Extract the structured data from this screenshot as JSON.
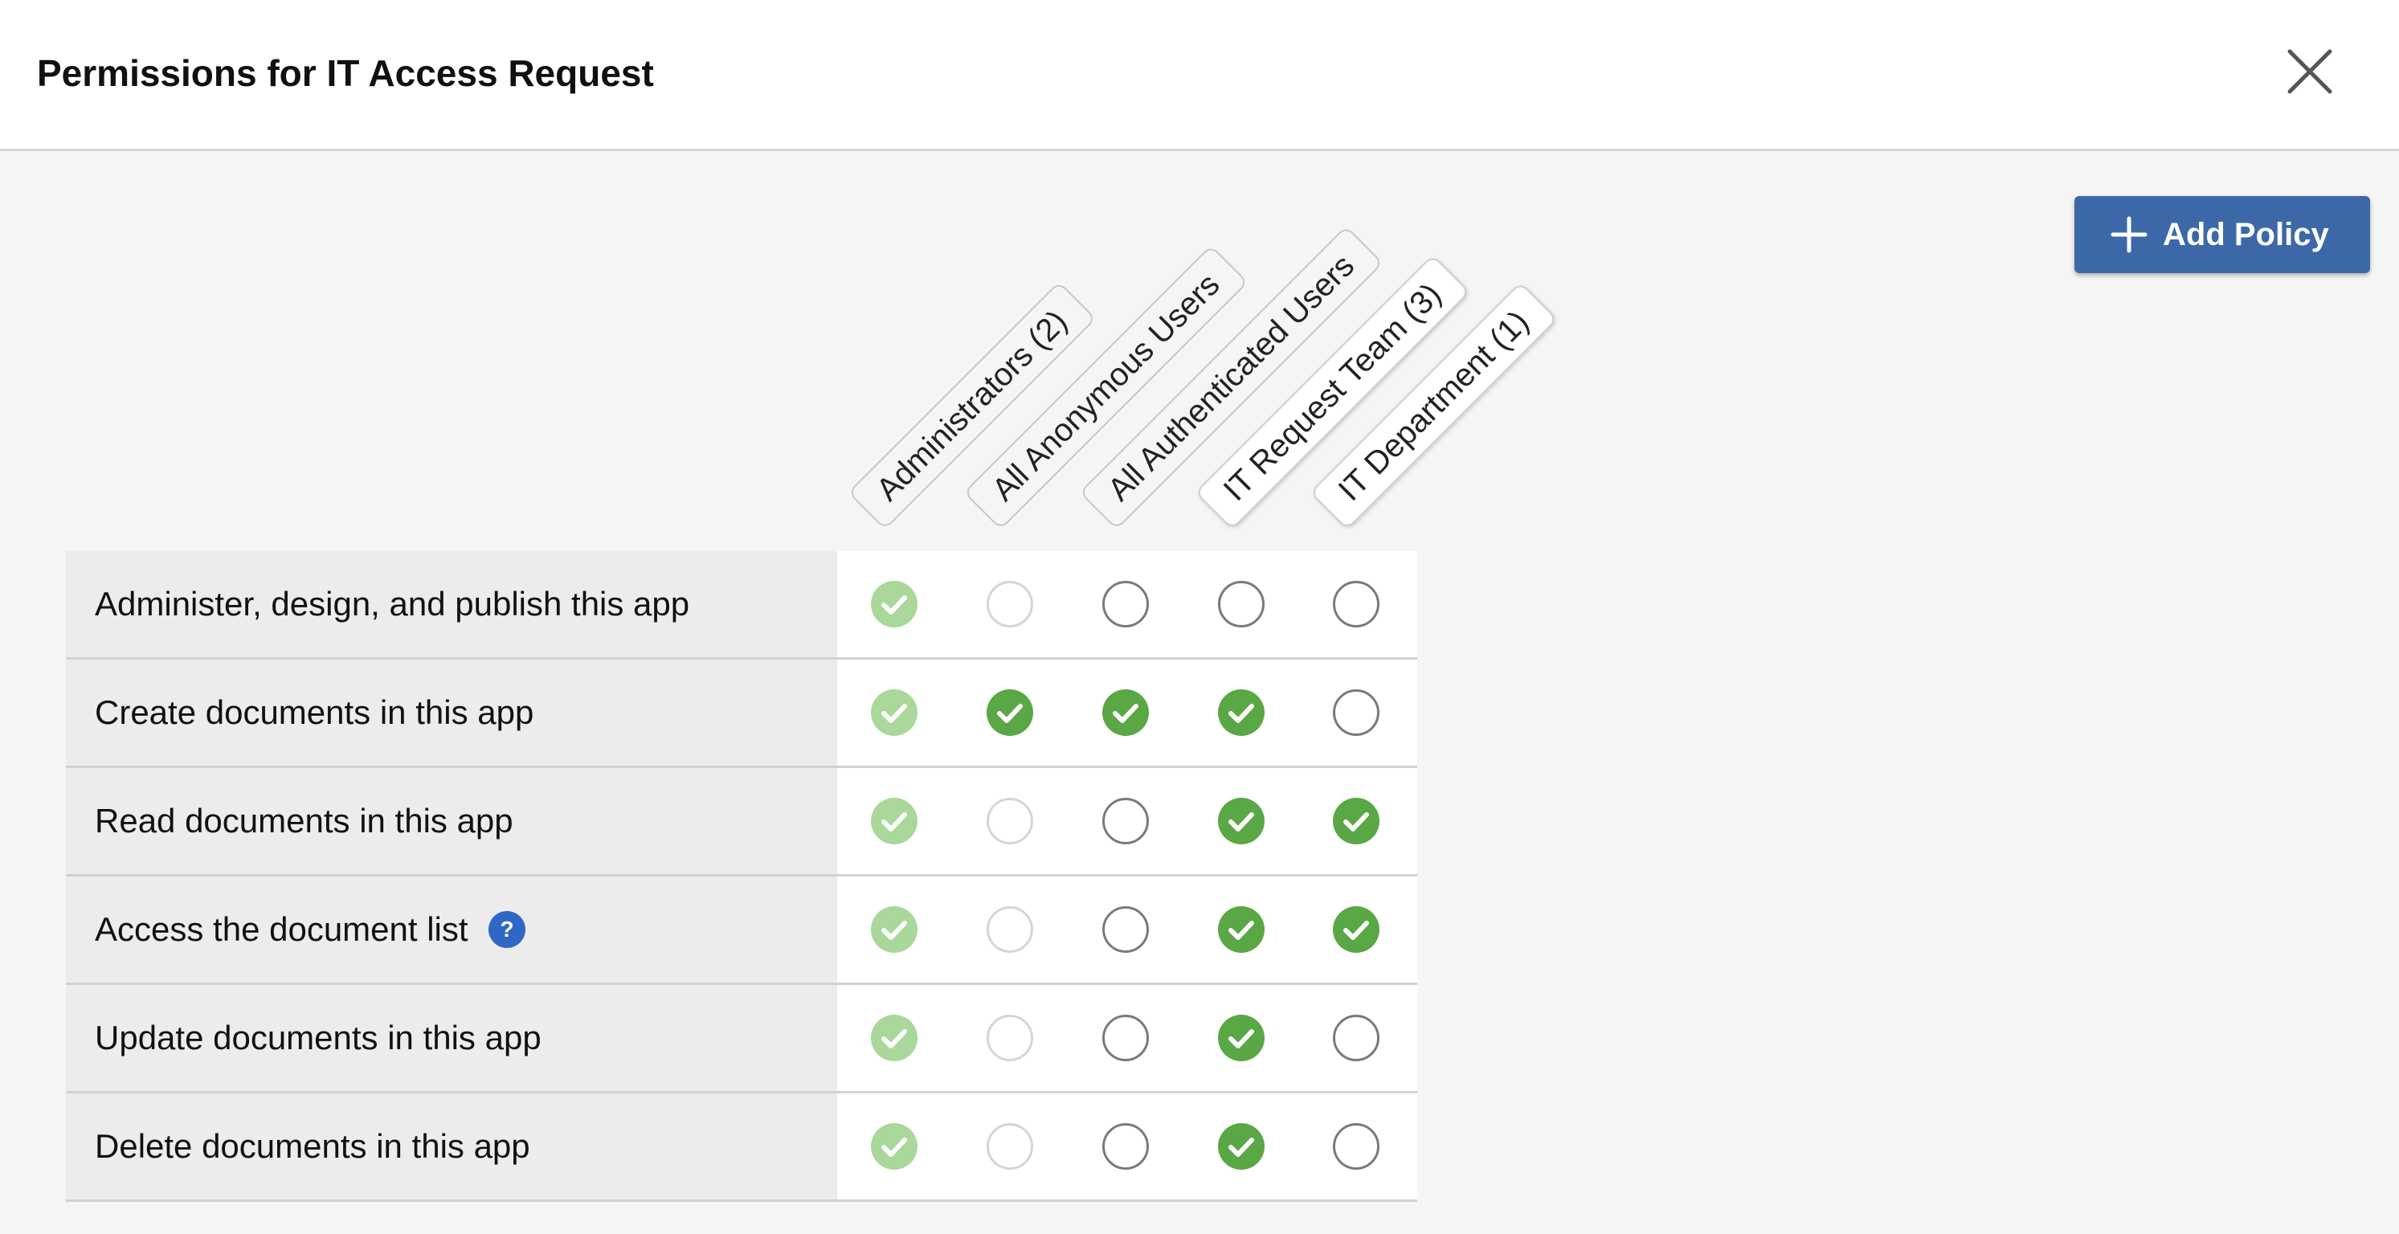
{
  "dialog": {
    "title": "Permissions for IT Access Request",
    "close_icon": "close-icon"
  },
  "toolbar": {
    "add_label": "Add Policy",
    "add_icon": "plus-icon"
  },
  "columns": [
    {
      "label": "Administrators (2)",
      "active": false
    },
    {
      "label": "All Anonymous Users",
      "active": false
    },
    {
      "label": "All Authenticated Users",
      "active": false
    },
    {
      "label": "IT Request Team (3)",
      "active": true
    },
    {
      "label": "IT Department (1)",
      "active": true
    }
  ],
  "rows": [
    {
      "label": "Administer, design, and publish this app",
      "help": false,
      "states": [
        "locked",
        "disabled",
        "off",
        "off",
        "off"
      ]
    },
    {
      "label": "Create documents in this app",
      "help": false,
      "states": [
        "locked",
        "on",
        "on",
        "on",
        "off"
      ]
    },
    {
      "label": "Read documents in this app",
      "help": false,
      "states": [
        "locked",
        "disabled",
        "off",
        "on",
        "on"
      ]
    },
    {
      "label": "Access the document list",
      "help": true,
      "states": [
        "locked",
        "disabled",
        "off",
        "on",
        "on"
      ]
    },
    {
      "label": "Update documents in this app",
      "help": false,
      "states": [
        "locked",
        "disabled",
        "off",
        "on",
        "off"
      ]
    },
    {
      "label": "Delete documents in this app",
      "help": false,
      "states": [
        "locked",
        "disabled",
        "off",
        "on",
        "off"
      ]
    }
  ],
  "colors": {
    "checked": "#5aa745",
    "locked": "#a9d89a",
    "unchecked_border": "#7a7a7a",
    "disabled_border": "#d5d5d5",
    "primary_button": "#3d68a8",
    "help": "#2f68c4"
  }
}
